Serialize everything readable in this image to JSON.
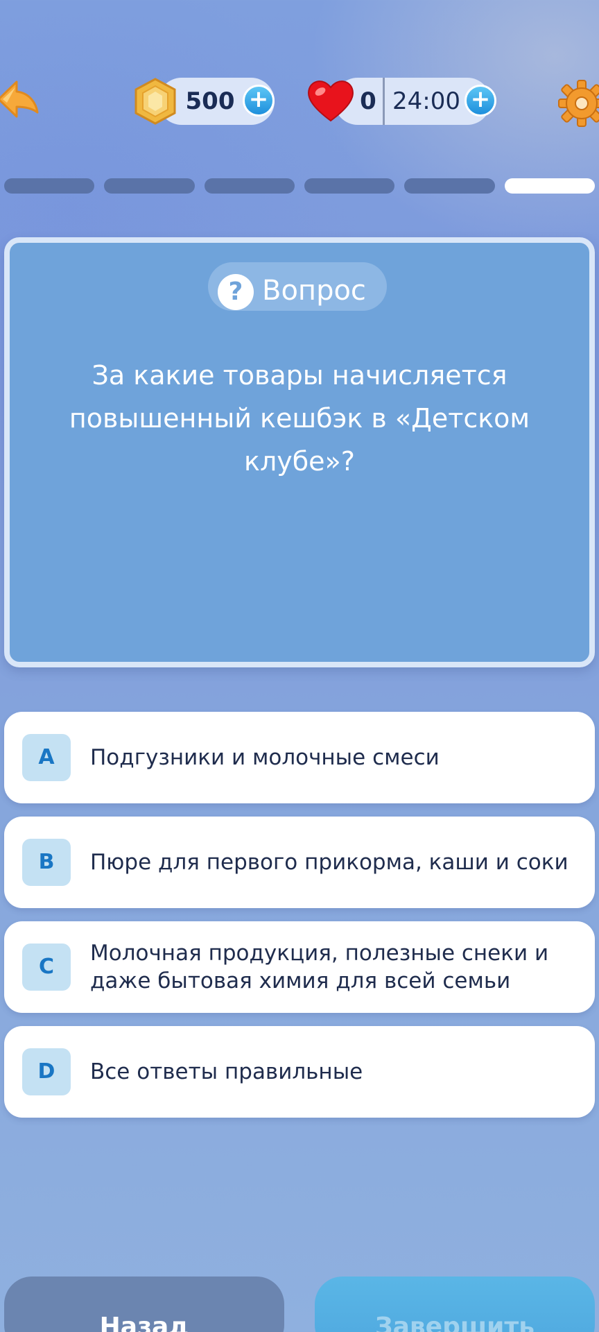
{
  "header": {
    "coins": "500",
    "lives": "0",
    "timer": "24:00",
    "plus_symbol": "+"
  },
  "progress": {
    "total": 6,
    "current": 6
  },
  "question": {
    "badge_icon": "?",
    "badge_label": "Вопрос",
    "text": "За какие товары начисляется повышенный кешбэк в «Детском клубе»?"
  },
  "answers": [
    {
      "letter": "A",
      "text": "Подгузники и молочные смеси"
    },
    {
      "letter": "B",
      "text": "Пюре для первого прикорма, каши и соки"
    },
    {
      "letter": "C",
      "text": "Молочная продукция, полезные снеки и даже бытовая химия для всей семьи"
    },
    {
      "letter": "D",
      "text": "Все ответы правильные"
    }
  ],
  "footer": {
    "back_label": "Назад",
    "finish_label": "Завершить"
  },
  "colors": {
    "accent": "#1e8fdc",
    "card": "#6fa3da",
    "text_dark": "#1f2c4d"
  }
}
